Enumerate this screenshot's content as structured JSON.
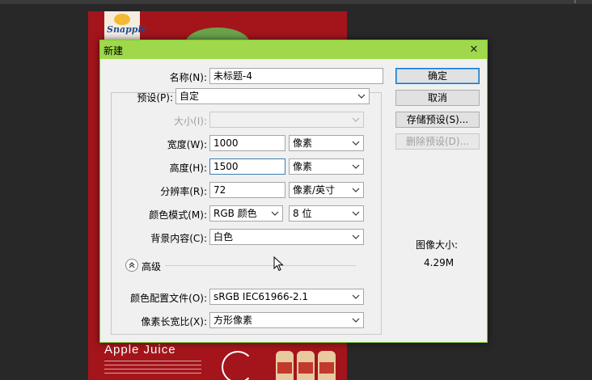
{
  "poster": {
    "logo_text": "Snapple",
    "title": "Apple Juice"
  },
  "dialog": {
    "title": "新建",
    "close_symbol": "✕",
    "fields": {
      "name": {
        "label": "名称(N):",
        "value": "未标题-4"
      },
      "preset": {
        "label": "预设(P):",
        "value": "自定"
      },
      "size": {
        "label": "大小(I):",
        "value": ""
      },
      "width": {
        "label": "宽度(W):",
        "value": "1000",
        "unit": "像素"
      },
      "height": {
        "label": "高度(H):",
        "value": "1500",
        "unit": "像素"
      },
      "resolution": {
        "label": "分辨率(R):",
        "value": "72",
        "unit": "像素/英寸"
      },
      "color_mode": {
        "label": "颜色模式(M):",
        "value": "RGB 颜色",
        "depth": "8 位"
      },
      "background": {
        "label": "背景内容(C):",
        "value": "白色"
      },
      "color_profile": {
        "label": "颜色配置文件(O):",
        "value": "sRGB IEC61966-2.1"
      },
      "pixel_aspect": {
        "label": "像素长宽比(X):",
        "value": "方形像素"
      }
    },
    "advanced_label": "高级",
    "buttons": {
      "ok": "确定",
      "cancel": "取消",
      "save_preset": "存储预设(S)...",
      "delete_preset": "删除预设(D)..."
    },
    "image_size": {
      "label": "图像大小:",
      "value": "4.29M"
    }
  },
  "colors": {
    "titlebar": "#9fd84b",
    "canvas": "#a3151b",
    "workspace": "#282828",
    "default_button_border": "#0078d7"
  }
}
